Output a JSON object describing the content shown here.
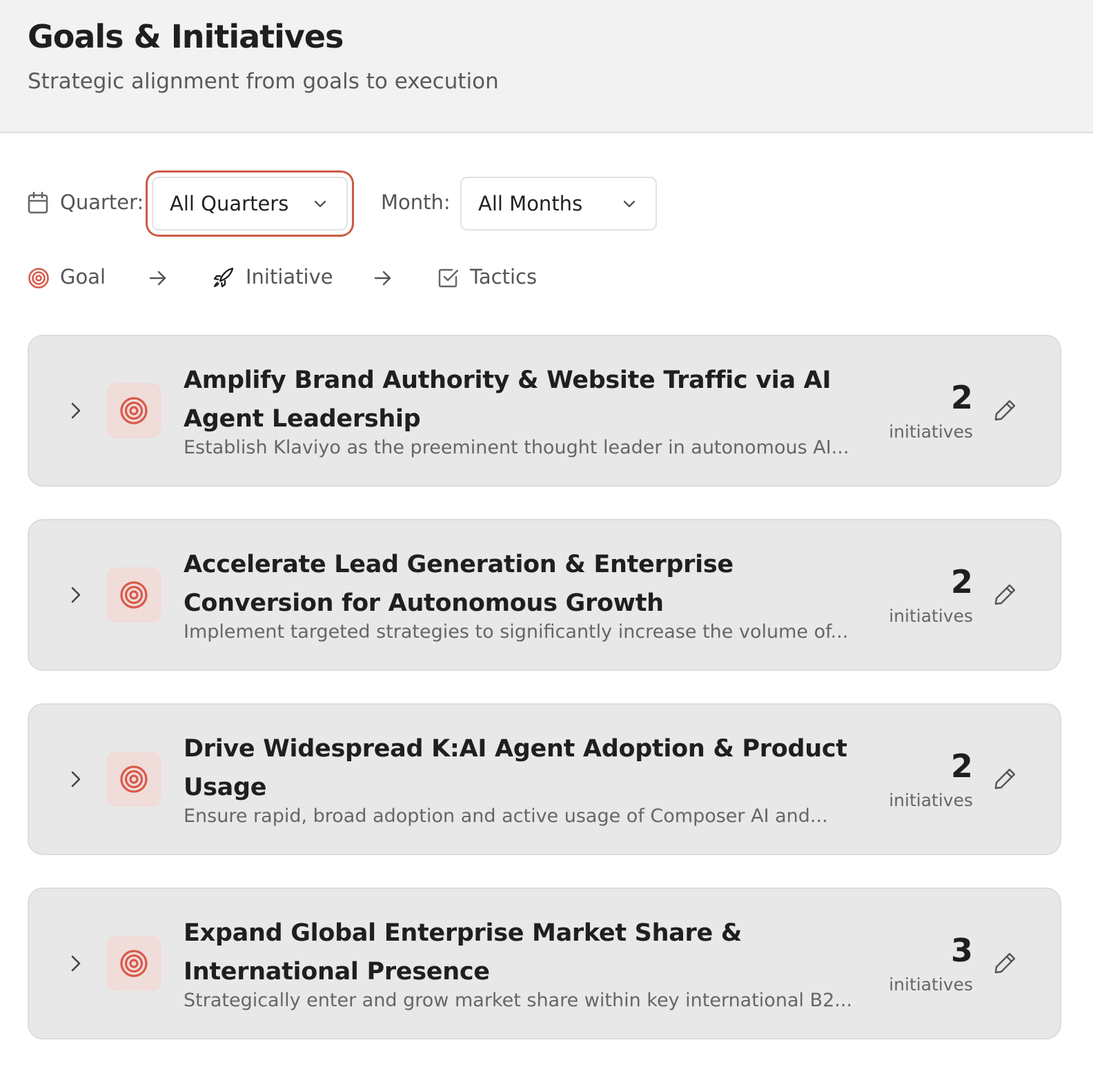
{
  "header": {
    "title": "Goals & Initiatives",
    "subtitle": "Strategic alignment from goals to execution"
  },
  "filters": {
    "quarter_label": "Quarter:",
    "quarter_value": "All Quarters",
    "month_label": "Month:",
    "month_value": "All Months"
  },
  "legend": {
    "goal": "Goal",
    "initiative": "Initiative",
    "tactics": "Tactics"
  },
  "colors": {
    "accent": "#d9594a",
    "badge_bg": "#f0dcd8",
    "card_bg": "#e8e8e8"
  },
  "goals": [
    {
      "title": "Amplify Brand Authority & Website Traffic via AI Agent Leadership",
      "description": "Establish Klaviyo as the preeminent thought leader in autonomous AI...",
      "count": "2",
      "count_label": "initiatives"
    },
    {
      "title": "Accelerate Lead Generation & Enterprise Conversion for Autonomous Growth",
      "description": "Implement targeted strategies to significantly increase the volume of...",
      "count": "2",
      "count_label": "initiatives"
    },
    {
      "title": "Drive Widespread K:AI Agent Adoption & Product Usage",
      "description": "Ensure rapid, broad adoption and active usage of Composer AI and...",
      "count": "2",
      "count_label": "initiatives"
    },
    {
      "title": "Expand Global Enterprise Market Share & International Presence",
      "description": "Strategically enter and grow market share within key international B2...",
      "count": "3",
      "count_label": "initiatives"
    }
  ]
}
